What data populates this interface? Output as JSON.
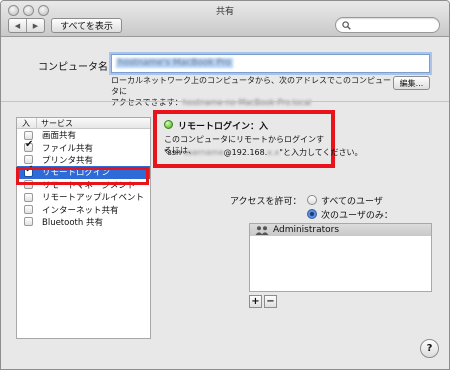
{
  "window": {
    "title": "共有"
  },
  "toolbar": {
    "back": "◀",
    "forward": "▶",
    "show_all": "すべてを表示",
    "search_value": ""
  },
  "computer_name": {
    "label": "コンピュータ名：",
    "value": "hostname's MacBook Pro",
    "desc_line1": "ローカルネットワーク上のコンピュータから、次のアドレスでこのコンピュータに",
    "desc_line2_prefix": "アクセスできます：",
    "desc_line2_addr": "hostname-no-MacBook-Pro.local",
    "edit_button": "編集..."
  },
  "services": {
    "header_on": "入",
    "header_service": "サービス",
    "items": [
      {
        "label": "画面共有",
        "checked": false,
        "selected": false
      },
      {
        "label": "ファイル共有",
        "checked": true,
        "selected": false
      },
      {
        "label": "プリンタ共有",
        "checked": false,
        "selected": false
      },
      {
        "label": "リモートログイン",
        "checked": true,
        "selected": true
      },
      {
        "label": "リモートマネージメント",
        "checked": false,
        "selected": false
      },
      {
        "label": "リモートアップルイベント",
        "checked": false,
        "selected": false
      },
      {
        "label": "インターネット共有",
        "checked": false,
        "selected": false
      },
      {
        "label": "Bluetooth 共有",
        "checked": false,
        "selected": false
      }
    ]
  },
  "status": {
    "title": "リモートログイン：入",
    "line1": "このコンピュータにリモートからログインするには、",
    "line2_prefix": "\"ssh ",
    "line2_user": "username",
    "line2_mid": "@192.168.",
    "line2_ip": "x.x",
    "line2_suffix": "\"と入力してください。"
  },
  "access": {
    "label": "アクセスを許可：",
    "option_all": "すべてのユーザ",
    "option_only": "次のユーザのみ：",
    "selected_option": "only",
    "users": [
      "Administrators"
    ],
    "add": "+",
    "remove": "−"
  },
  "help": "?"
}
